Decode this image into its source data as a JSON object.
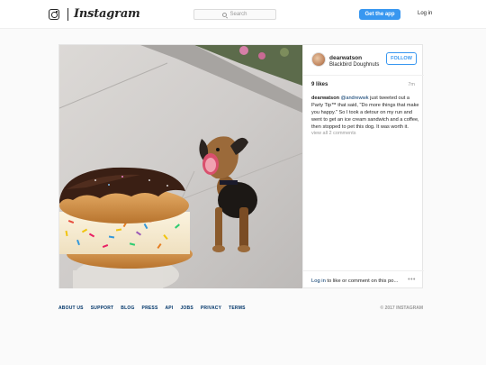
{
  "header": {
    "wordmark": "Instagram",
    "search_placeholder": "Search",
    "get_app_label": "Get the app",
    "login_label": "Log in",
    "accent_color": "#3897f0"
  },
  "post": {
    "username": "dearwatson",
    "location": "Blackbird Doughnuts",
    "follow_label": "FOLLOW",
    "likes": "9 likes",
    "time": "7m",
    "caption_user": "dearwatson",
    "caption_mention": "@andrewwk",
    "caption_text": " just tweeted out a Party Tip™ that said, \"Do more things that make you happy.\" So I took a detour on my run and went to get an ice cream sandwich and a coffee, then stopped to pet this dog. It was worth it.",
    "view_comments": "view all 2 comments",
    "login_link": "Log in",
    "login_rest": " to like or comment on this po...",
    "more_icon": "•••"
  },
  "footer": {
    "links": [
      "ABOUT US",
      "SUPPORT",
      "BLOG",
      "PRESS",
      "API",
      "JOBS",
      "PRIVACY",
      "TERMS"
    ],
    "copyright": "© 2017 INSTAGRAM"
  }
}
